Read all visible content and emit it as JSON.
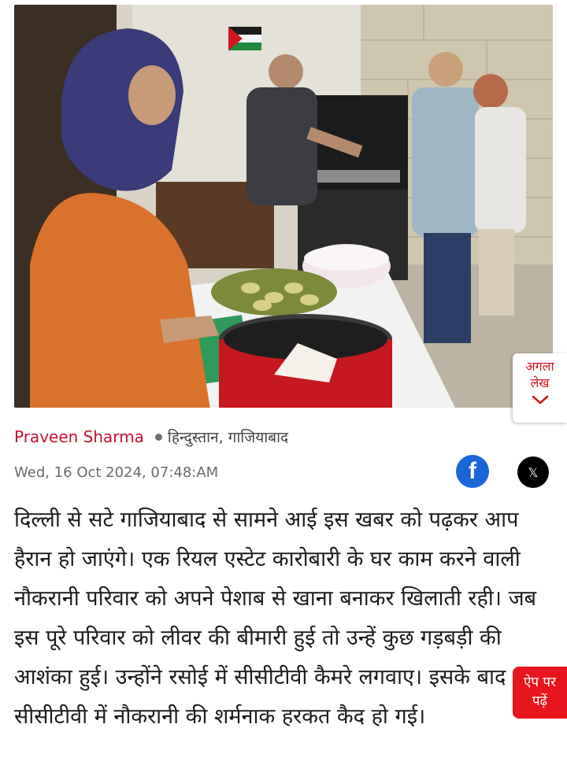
{
  "hero_image": {
    "alt": "Kitchen scene"
  },
  "next_article": {
    "line1": "अगला",
    "line2": "लेख",
    "icon": "chevron-down-icon"
  },
  "byline": {
    "author": "Praveen Sharma",
    "source": "हिन्दुस्तान, गाजियाबाद"
  },
  "date": "Wed, 16 Oct 2024, 07:48:AM",
  "share": {
    "facebook_icon": "f",
    "x_icon": "𝕏"
  },
  "article": {
    "text": "दिल्ली से सटे गाजियाबाद से सामने आई इस खबर को पढ़कर आप हैरान हो जाएंगे। एक रियल एस्टेट कारोबारी के घर काम करने वाली नौकरानी परिवार को अपने पेशाब से खाना बनाकर खिलाती रही। जब इस पूरे परिवार को लीवर की बीमारी हुई तो उन्हें कुछ गड़बड़ी की आशंका हुई। उन्होंने रसोई में सीसीटीवी कैमरे लगवाए। इसके बाद सीसीटीवी में नौकरानी की शर्मनाक हरकत कैद हो गई।"
  },
  "app_badge": {
    "line1": "ऐप पर",
    "line2": "पढ़ें"
  },
  "colors": {
    "accent_red": "#c8102e",
    "facebook_blue": "#1a66d8",
    "badge_red": "#e8151d"
  }
}
